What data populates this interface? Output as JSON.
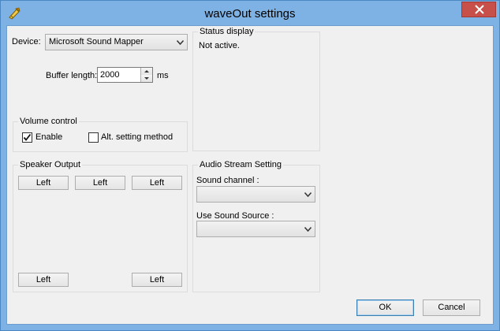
{
  "window": {
    "title": "waveOut settings"
  },
  "device": {
    "label": "Device:",
    "selected": "Microsoft Sound Mapper"
  },
  "buffer": {
    "label": "Buffer length:",
    "value": "2000",
    "unit": "ms"
  },
  "volume": {
    "title": "Volume control",
    "enable_label": "Enable",
    "enable_checked": true,
    "alt_label": "Alt. setting method",
    "alt_checked": false
  },
  "speaker": {
    "title": "Speaker Output",
    "top_buttons": [
      "Left",
      "Left",
      "Left"
    ],
    "bottom_buttons": [
      "Left",
      "Left"
    ]
  },
  "status": {
    "title": "Status display",
    "text": "Not active."
  },
  "audio_stream": {
    "title": "Audio Stream Setting",
    "sound_channel_label": "Sound channel :",
    "sound_channel_value": "",
    "sound_source_label": "Use Sound Source :",
    "sound_source_value": ""
  },
  "buttons": {
    "ok": "OK",
    "cancel": "Cancel"
  },
  "colors": {
    "titlebar": "#7fb2e4",
    "close": "#c7504a",
    "dialog_bg": "#f0f0f0"
  }
}
